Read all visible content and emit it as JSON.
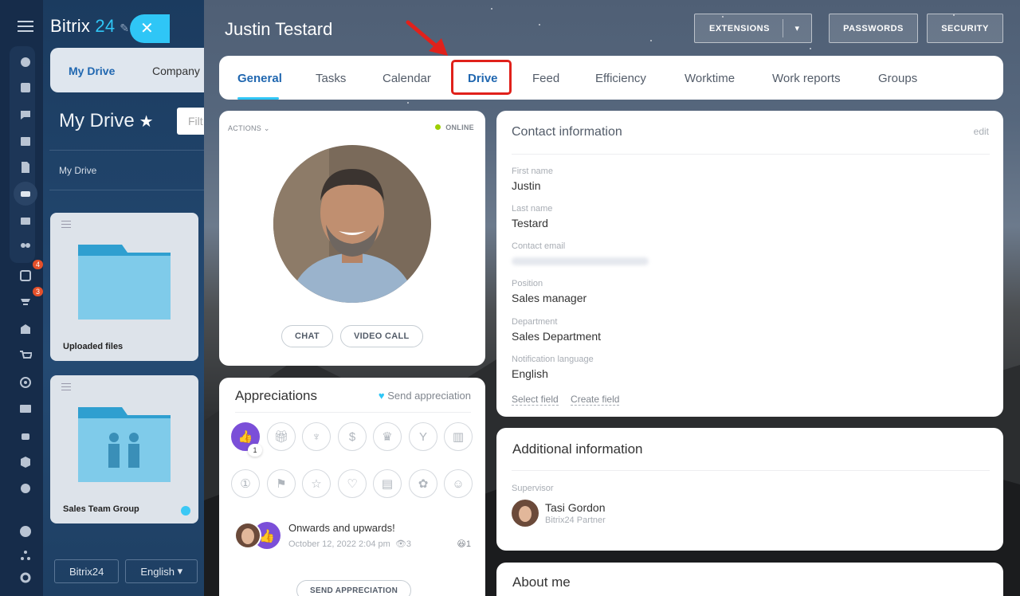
{
  "bitrix_logo": {
    "text": "Bitrix",
    "accent": "24"
  },
  "drive_bg": {
    "tabs": [
      "My Drive",
      "Company"
    ],
    "title": "My Drive",
    "filter_placeholder": "Filt",
    "breadcrumb": "My Drive",
    "cards": [
      {
        "label": "Uploaded files"
      },
      {
        "label": "Sales Team Group"
      }
    ],
    "footer_brand": "Bitrix24",
    "language": "English"
  },
  "rail": {
    "badges": [
      "4",
      "3"
    ]
  },
  "profile": {
    "name": "Justin Testard",
    "header_buttons": {
      "extensions": "EXTENSIONS",
      "passwords": "PASSWORDS",
      "security": "SECURITY"
    },
    "tabs": [
      "General",
      "Tasks",
      "Calendar",
      "Drive",
      "Feed",
      "Efficiency",
      "Worktime",
      "Work reports",
      "Groups"
    ],
    "active_tab": "General",
    "highlighted_tab": "Drive",
    "card": {
      "actions": "ACTIONS",
      "status": "ONLINE",
      "chat": "CHAT",
      "video_call": "VIDEO CALL"
    },
    "contact": {
      "title": "Contact information",
      "edit": "edit",
      "fields": [
        {
          "label": "First name",
          "value": "Justin"
        },
        {
          "label": "Last name",
          "value": "Testard"
        },
        {
          "label": "Contact email",
          "value": ""
        },
        {
          "label": "Position",
          "value": "Sales manager"
        },
        {
          "label": "Department",
          "value": "Sales Department"
        },
        {
          "label": "Notification language",
          "value": "English"
        }
      ],
      "select_field": "Select field",
      "create_field": "Create field"
    },
    "additional": {
      "title": "Additional information",
      "supervisor_label": "Supervisor",
      "supervisor_name": "Tasi Gordon",
      "supervisor_role": "Bitrix24 Partner"
    },
    "about": {
      "title": "About me"
    },
    "appreciations": {
      "title": "Appreciations",
      "send_link": "Send appreciation",
      "like_count": "1",
      "post": {
        "text": "Onwards and upwards!",
        "date": "October 12, 2022 2:04 pm",
        "views": "3",
        "reactions": "1"
      },
      "send_button": "SEND APPRECIATION"
    }
  },
  "colors": {
    "accent": "#2fc6f6",
    "active_tab": "#2067b0",
    "highlight": "#e0211b",
    "online": "#9dcf00"
  }
}
